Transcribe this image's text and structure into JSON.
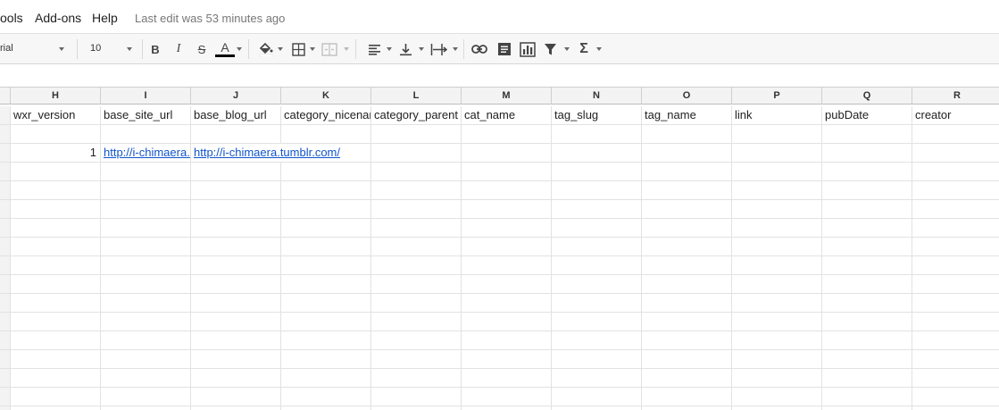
{
  "menu": {
    "tools": "ools",
    "addons": "Add-ons",
    "help": "Help",
    "last_edit": "Last edit was 53 minutes ago"
  },
  "toolbar": {
    "font_name": "rial",
    "font_size": "10",
    "bold": "B",
    "italic": "I",
    "strike": "S",
    "text_color": "A",
    "sum": "Σ"
  },
  "columns": [
    "H",
    "I",
    "J",
    "K",
    "L",
    "M",
    "N",
    "O",
    "P",
    "Q",
    "R"
  ],
  "rows": [
    [
      "wxr_version",
      "base_site_url",
      "base_blog_url",
      "category_nicename",
      "category_parent",
      "cat_name",
      "tag_slug",
      "tag_name",
      "link",
      "pubDate",
      "creator"
    ],
    [
      "",
      "",
      "",
      "",
      "",
      "",
      "",
      "",
      "",
      "",
      ""
    ],
    [
      "1",
      "http://i-chimaera.tumblr.com/",
      "http://i-chimaera.tumblr.com/",
      "",
      "",
      "",
      "",
      "",
      "",
      "",
      ""
    ]
  ],
  "colors": {
    "link": "#1155cc",
    "header_bg": "#f3f3f3",
    "toolbar_bg": "#f7f7f7"
  }
}
